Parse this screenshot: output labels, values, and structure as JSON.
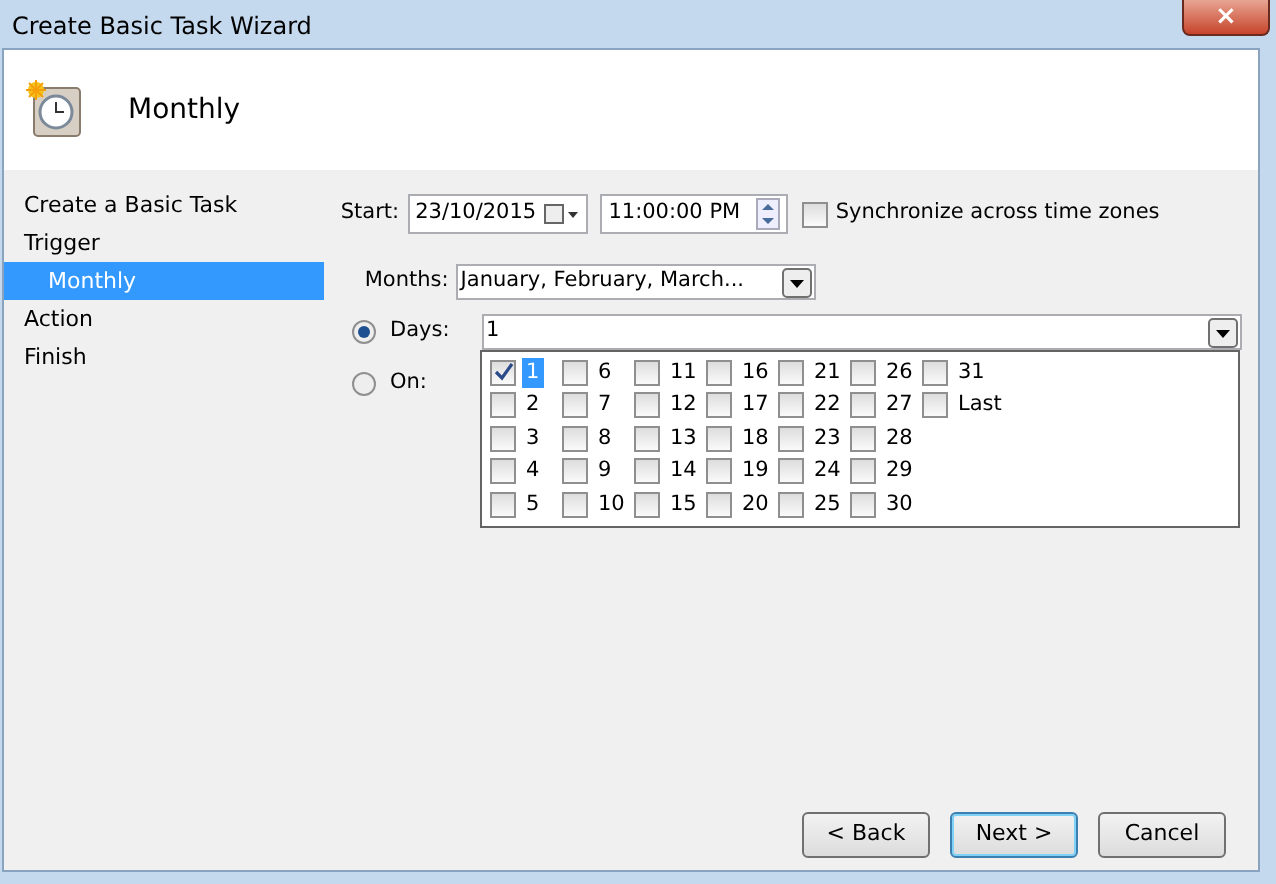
{
  "window": {
    "title": "Create Basic Task Wizard",
    "close": "×"
  },
  "header": {
    "title": "Monthly"
  },
  "nav": [
    {
      "label": "Create a Basic Task",
      "selected": false
    },
    {
      "label": "Trigger",
      "selected": false,
      "children": [
        {
          "label": "Monthly",
          "selected": true
        }
      ]
    },
    {
      "label": "Action",
      "selected": false
    },
    {
      "label": "Finish",
      "selected": false
    }
  ],
  "start": {
    "label": "Start:",
    "date": "23/10/2015",
    "time": "11:00:00 PM"
  },
  "sync": {
    "label": "Synchronize across time zones",
    "checked": false
  },
  "months": {
    "label": "Months:",
    "value": "January, February, March..."
  },
  "mode": [
    {
      "label": "Days:",
      "selected": true
    },
    {
      "label": "On:",
      "selected": false
    }
  ],
  "days_field": {
    "value": "1"
  },
  "days": [
    {
      "label": "1",
      "checked": true,
      "selected": true
    },
    {
      "label": "2",
      "checked": false,
      "selected": false
    },
    {
      "label": "3",
      "checked": false,
      "selected": false
    },
    {
      "label": "4",
      "checked": false,
      "selected": false
    },
    {
      "label": "5",
      "checked": false,
      "selected": false
    },
    {
      "label": "6",
      "checked": false,
      "selected": false
    },
    {
      "label": "7",
      "checked": false,
      "selected": false
    },
    {
      "label": "8",
      "checked": false,
      "selected": false
    },
    {
      "label": "9",
      "checked": false,
      "selected": false
    },
    {
      "label": "10",
      "checked": false,
      "selected": false
    },
    {
      "label": "11",
      "checked": false,
      "selected": false
    },
    {
      "label": "12",
      "checked": false,
      "selected": false
    },
    {
      "label": "13",
      "checked": false,
      "selected": false
    },
    {
      "label": "14",
      "checked": false,
      "selected": false
    },
    {
      "label": "15",
      "checked": false,
      "selected": false
    },
    {
      "label": "16",
      "checked": false,
      "selected": false
    },
    {
      "label": "17",
      "checked": false,
      "selected": false
    },
    {
      "label": "18",
      "checked": false,
      "selected": false
    },
    {
      "label": "19",
      "checked": false,
      "selected": false
    },
    {
      "label": "20",
      "checked": false,
      "selected": false
    },
    {
      "label": "21",
      "checked": false,
      "selected": false
    },
    {
      "label": "22",
      "checked": false,
      "selected": false
    },
    {
      "label": "23",
      "checked": false,
      "selected": false
    },
    {
      "label": "24",
      "checked": false,
      "selected": false
    },
    {
      "label": "25",
      "checked": false,
      "selected": false
    },
    {
      "label": "26",
      "checked": false,
      "selected": false
    },
    {
      "label": "27",
      "checked": false,
      "selected": false
    },
    {
      "label": "28",
      "checked": false,
      "selected": false
    },
    {
      "label": "29",
      "checked": false,
      "selected": false
    },
    {
      "label": "30",
      "checked": false,
      "selected": false
    },
    {
      "label": "31",
      "checked": false,
      "selected": false
    },
    {
      "label": "Last",
      "checked": false,
      "selected": false
    }
  ],
  "buttons": [
    {
      "label": "< Back",
      "default": false
    },
    {
      "label": "Next >",
      "default": true
    },
    {
      "label": "Cancel",
      "default": false
    }
  ]
}
